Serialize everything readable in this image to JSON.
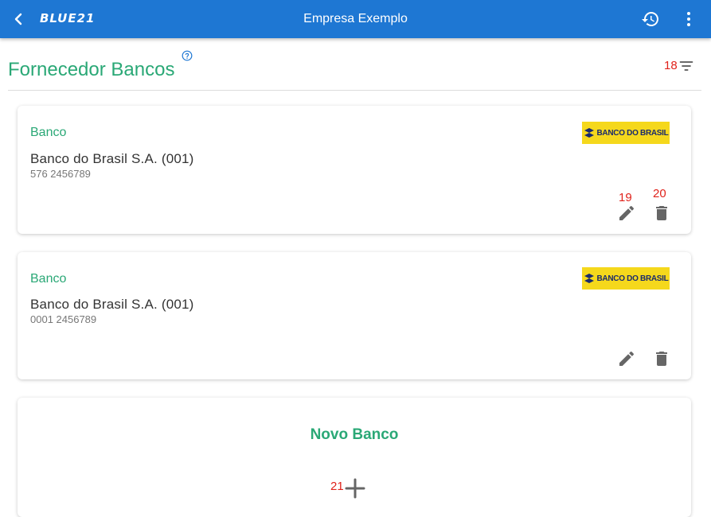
{
  "appbar": {
    "logo": "BLUE21",
    "title": "Empresa Exemplo",
    "icons": [
      "back-arrow-icon",
      "history-icon",
      "more-vert-icon"
    ]
  },
  "header": {
    "title": "Fornecedor Bancos",
    "filter_count": "18"
  },
  "cards": [
    {
      "label": "Banco",
      "bank_name": "Banco do Brasil S.A. (001)",
      "account": "576 2456789",
      "logo_text": "BANCO DO BRASIL",
      "edit_num": "19",
      "delete_num": "20"
    },
    {
      "label": "Banco",
      "bank_name": "Banco do Brasil S.A. (001)",
      "account": "0001 2456789",
      "logo_text": "BANCO DO BRASIL"
    }
  ],
  "new_bank": {
    "title": "Novo Banco",
    "add_num": "21"
  },
  "colors": {
    "appbar": "#1e77d3",
    "accent_green": "#2aa876",
    "annotation_red": "#e0221b",
    "logo_yellow": "#f5d81c"
  }
}
